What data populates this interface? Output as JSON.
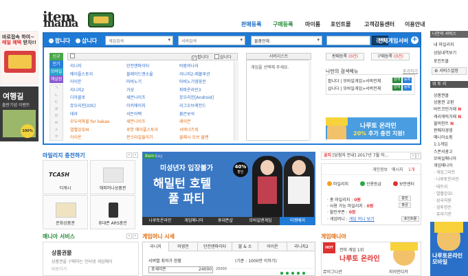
{
  "header": {
    "logo_line1": "item",
    "logo_line2": "mania",
    "nav": [
      "판매등록",
      "구매등록",
      "마이룸",
      "포인트몰",
      "고객감동센터",
      "이용안내"
    ]
  },
  "left_banners": {
    "b1_line1": "바로접속 하여~",
    "b1_line2": "매일 혜택",
    "b1_line3": "받자!!",
    "b2_title": "여행길",
    "b2_sub": "출판기념 이벤트",
    "b2_badge": "100%"
  },
  "search": {
    "radio_sell": "팝니다",
    "radio_buy": "삽니다",
    "game_placeholder": "게임검색",
    "server_placeholder": "서버검색",
    "category_value": "물품전체",
    "search_button": "검색",
    "all_games": "전체게임서버"
  },
  "categories": [
    {
      "label": "신규",
      "color": "#4aa64a"
    },
    {
      "label": "인기",
      "color": "#2a80d8"
    },
    {
      "label": "모바일",
      "color": "#2aa6c8"
    },
    {
      "label": "채널링",
      "color": "#8a5ad0"
    }
  ],
  "game_list": {
    "sell_check": "팝니다",
    "buy_check": "삽니다",
    "games": [
      {
        "name": "리니지",
        "hot": false
      },
      {
        "name": "던전앤파이터",
        "hot": false
      },
      {
        "name": "바람의나라",
        "hot": false
      },
      {
        "name": "메이플스토리",
        "hot": false
      },
      {
        "name": "블레이드앤소울",
        "hot": false
      },
      {
        "name": "리니지2:레볼루션",
        "hot": true
      },
      {
        "name": "아이온",
        "hot": false
      },
      {
        "name": "마비노기",
        "hot": false
      },
      {
        "name": "마비노기영웅전",
        "hot": true
      },
      {
        "name": "리니지2",
        "hot": true
      },
      {
        "name": "거상",
        "hot": true
      },
      {
        "name": "파파온라인3",
        "hot": false
      },
      {
        "name": "디아블로",
        "hot": false
      },
      {
        "name": "세븐나이츠",
        "hot": false
      },
      {
        "name": "뮤오리진[Android]",
        "hot": false
      },
      {
        "name": "뮤오리진[iOS]",
        "hot": false
      },
      {
        "name": "아키에이지",
        "hot": false
      },
      {
        "name": "리그오브레전드",
        "hot": false
      },
      {
        "name": "테라",
        "hot": false
      },
      {
        "name": "서든어택",
        "hot": false
      },
      {
        "name": "붉은보석",
        "hot": false
      },
      {
        "name": "모두의마블 for kakao",
        "hot": false
      },
      {
        "name": "세븐나이츠",
        "hot": false
      },
      {
        "name": "레이븐",
        "hot": false
      },
      {
        "name": "열혈강호M",
        "hot": false
      },
      {
        "name": "로한 메이플스토리",
        "hot": false
      },
      {
        "name": "서머너즈워",
        "hot": false
      },
      {
        "name": "아이온",
        "hot": false
      },
      {
        "name": "몬스터길들이기",
        "hot": false
      },
      {
        "name": "클래시 오브 클랜",
        "hot": false
      }
    ]
  },
  "server_list": {
    "header": "서버리스트",
    "empty_message": "게임을 선택해 주세요."
  },
  "right_panel": {
    "sell_label": "판매등록",
    "sell_count": "(0건)",
    "buy_label": "구매등록",
    "buy_count": "(0건)",
    "recent_title": "나만의 검색메뉴",
    "recent_add": "추가하기",
    "recent": [
      {
        "text": "팝니다 | 모바일게임>서버전체"
      },
      {
        "text": "삽니다 | 모바일게임>서버전체"
      }
    ],
    "mini_btn_a": "검색",
    "mini_btn_b": "등록",
    "promo_line1": "나루토 온라인",
    "promo_line2_a": "20%",
    "promo_line2_b": "추가 충전 지원!"
  },
  "right_sidebar": {
    "my_service": "나만의 서비스",
    "items1": [
      "내 마일리지",
      "상담내역보기",
      "포인트몰"
    ],
    "settings": "서비스설정",
    "wish_head": "위 토 리",
    "items2": [
      {
        "label": "상품권몰",
        "new": false,
        "sub": false
      },
      {
        "label": "상품권 교환",
        "new": false,
        "sub": false
      },
      {
        "label": "바트코인거래",
        "new": true,
        "sub": false
      },
      {
        "label": "캐리캐릭거래",
        "new": true,
        "sub": false
      },
      {
        "label": "윌머천트",
        "new": true,
        "sub": false
      },
      {
        "label": "판매자경영",
        "new": false,
        "sub": false
      },
      {
        "label": "매니아쇼핑",
        "new": false,
        "sub": false
      },
      {
        "label": "1:1게임",
        "new": false,
        "sub": false
      },
      {
        "label": "스폰서광고",
        "new": false,
        "sub": false
      },
      {
        "label": "모바일매니아",
        "new": false,
        "sub": false
      },
      {
        "label": "게임매니아",
        "new": false,
        "sub": false
      },
      {
        "label": "· 게임그리트",
        "new": false,
        "sub": true
      },
      {
        "label": "· 나루토온라인",
        "new": false,
        "sub": true
      },
      {
        "label": "· 테트리",
        "new": false,
        "sub": true
      },
      {
        "label": "· 열혈강호Ⅰ",
        "new": false,
        "sub": true
      },
      {
        "label": "· 삼국지원",
        "new": false,
        "sub": true
      },
      {
        "label": "· 검투천손",
        "new": false,
        "sub": true
      },
      {
        "label": "· 쥬라기천",
        "new": false,
        "sub": true
      }
    ],
    "banner_line1": "나루토온라인",
    "banner_line2": "모바일"
  },
  "mileage": {
    "title": "마일리지 충전하기",
    "tiles": [
      "티캐시",
      "해피머니상품권",
      "문화상품권",
      "휴대폰 ARS충전"
    ],
    "tcash_logo": "TCASH"
  },
  "main_banner": {
    "brand_tag": "Item",
    "brand_name": "bay",
    "line1": "미성년자 입장불가",
    "line2": "해밀턴 호텔",
    "line3": "풀 파티",
    "discount_pct": "40%",
    "discount_label": "할인",
    "tabs": [
      "나루토온라인",
      "게임매니아",
      "휴대폰샵",
      "모바일엔게임",
      "티켓베이"
    ],
    "active_tab": 4
  },
  "notice": {
    "label": "공지",
    "text": "[당첨자 안내] 2017년 7월 하..."
  },
  "user": {
    "links": [
      "개인정보",
      "메시지",
      "1개"
    ],
    "icons": [
      {
        "label": "마일리지",
        "color": "#f2a01e"
      },
      {
        "label": "신용등급",
        "color": "#2aa64a"
      },
      {
        "label": "보안센터",
        "color": "#e03030"
      }
    ],
    "rows": [
      {
        "label": "· 총 마일리지 :",
        "value": "0원"
      },
      {
        "label": "· 사용 가능 마일리지 :",
        "value": "0원"
      },
      {
        "label": "· 할인쿠폰 :",
        "value": "0장"
      },
      {
        "label": "· 게임머니 :",
        "value": "게임 머니 보기"
      }
    ],
    "btn_charge": "충전",
    "btn_withdraw": "출금",
    "btn_point": "포인트몰"
  },
  "service": {
    "title": "매니아 서비스",
    "box_title": "상품권몰",
    "box_line1": "상품권을 구매하는 인터넷 게임메이",
    "box_line2": "바로가기"
  },
  "quote": {
    "title": "게임머니 시세",
    "tabs": [
      "리니지",
      "마영전",
      "던전앤파이터",
      "블 & 소",
      "아이온",
      "리니지2"
    ],
    "active_tab": 0,
    "subtitle": "서버별 최저가 현황",
    "unit_note": "(기준 : 1000만 이하기)",
    "server": "포세이돈",
    "price": "24000",
    "chart_label": "25000"
  },
  "gamemania": {
    "title": "게임매니아",
    "hot": "HOT",
    "line1": "전미 게임 1위",
    "line2": "나루토 온라인",
    "link1": "뮤이그니션",
    "link2": "지이언디카"
  }
}
